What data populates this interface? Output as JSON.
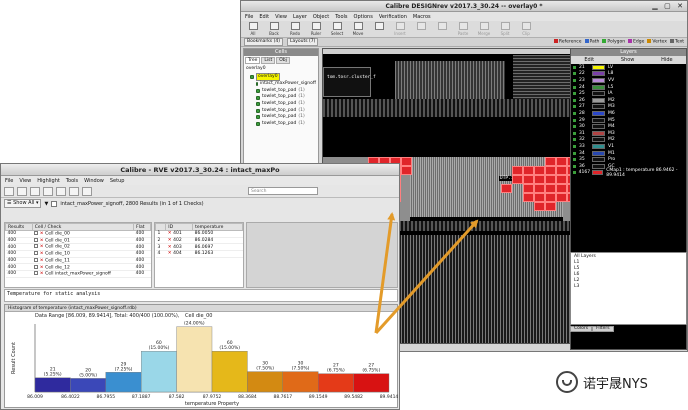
{
  "designrev": {
    "title": "Calibre DESIGNrev v2017.3_30.24  --  overlay0 *",
    "menu": [
      "File",
      "Edit",
      "View",
      "Layer",
      "Object",
      "Tools",
      "Options",
      "Verification",
      "Macros"
    ],
    "toolbar": [
      "All",
      "Back",
      "Redo",
      "Ruler",
      "Select",
      "Move",
      "",
      "Insert",
      "",
      "",
      "Paste",
      "Merge",
      "Split",
      "Clip"
    ],
    "bookmarks": "Bookmarks (4)",
    "layouts": "Layouts (7)",
    "legend": [
      "Reference",
      "Path",
      "Polygon",
      "Edge",
      "Vertex",
      "Text"
    ],
    "legend_colors": [
      "#cc2222",
      "#3366cc",
      "#33aa33",
      "#aa33aa",
      "#cc8800",
      "#666666"
    ],
    "cells": {
      "header": "Cells",
      "tabs": [
        "Tree",
        "List",
        "Obj"
      ],
      "root_label": "overlay0",
      "top": "overlay0",
      "items": [
        {
          "name": "intact_maxPower_signoff",
          "count": ""
        },
        {
          "name": "towlet_top_pad",
          "count": "(1)"
        },
        {
          "name": "towlet_top_pad",
          "count": "(1)"
        },
        {
          "name": "towlet_top_pad",
          "count": "(1)"
        },
        {
          "name": "towlet_top_pad",
          "count": "(1)"
        },
        {
          "name": "towlet_top_pad",
          "count": "(1)"
        },
        {
          "name": "towlet_top_pad",
          "count": "(1)"
        }
      ]
    },
    "canvas": {
      "labels": [
        "tom.tosr.cluster_f",
        "tom.tosr.cluster_f",
        "tom.tosr.cluster_f",
        "tom.tosr.cluster_f",
        "DTP.io"
      ]
    },
    "layers": {
      "header": "Layers",
      "tabs": [
        "Edit",
        "Show",
        "Hide"
      ],
      "rows": [
        {
          "num": "21",
          "name": "LV",
          "color": "#f5f500"
        },
        {
          "num": "22",
          "name": "L8",
          "color": "#7a3fa8"
        },
        {
          "num": "23",
          "name": "VV",
          "color": "#b88ad6"
        },
        {
          "num": "24",
          "name": "L5",
          "color": "#3b8d3b"
        },
        {
          "num": "25",
          "name": "IA",
          "color": "#111111"
        },
        {
          "num": "26",
          "name": "M2",
          "color": "#9b9b9b"
        },
        {
          "num": "27",
          "name": "M3",
          "color": "#111111"
        },
        {
          "num": "28",
          "name": "M6",
          "color": "#2b47c9"
        },
        {
          "num": "29",
          "name": "M5",
          "color": "#111111"
        },
        {
          "num": "30",
          "name": "M4",
          "color": "#111111"
        },
        {
          "num": "31",
          "name": "M3",
          "color": "#b04444"
        },
        {
          "num": "32",
          "name": "M2",
          "color": "#111111"
        },
        {
          "num": "33",
          "name": "V1",
          "color": "#2f8f8f"
        },
        {
          "num": "34",
          "name": "M1",
          "color": "#2848b0"
        },
        {
          "num": "35",
          "name": "Pro",
          "color": "#111111"
        },
        {
          "num": "36",
          "name": "GC",
          "color": "#111111"
        },
        {
          "num": "4167",
          "name": "CMap1 : temperature 86.9462 - 89.9414",
          "color": "#e0252a"
        }
      ],
      "all_layers": [
        "All Layers",
        "L1",
        "L5",
        "L6",
        "L2",
        "L3"
      ],
      "bottom_tabs": [
        "Colors",
        "Filters"
      ]
    }
  },
  "rve": {
    "title": "Calibre - RVE v2017.3_30.24 : intact_maxPo",
    "menu": [
      "File",
      "View",
      "Highlight",
      "Tools",
      "Window",
      "Setup"
    ],
    "search_placeholder": "Search",
    "show_all": "Show All",
    "summary": "intact_maxPower_signoff, 2800 Results (in 1 of 1 Checks)",
    "left_table": {
      "headers": [
        "Results",
        "Cell / Check",
        "Flat"
      ],
      "rows": [
        {
          "results": "400",
          "name": "Cell die_00",
          "flat": "400"
        },
        {
          "results": "400",
          "name": "Cell die_01",
          "flat": "400"
        },
        {
          "results": "400",
          "name": "Cell die_02",
          "flat": "400"
        },
        {
          "results": "400",
          "name": "Cell die_10",
          "flat": "400"
        },
        {
          "results": "400",
          "name": "Cell die_11",
          "flat": "400"
        },
        {
          "results": "400",
          "name": "Cell die_12",
          "flat": "400"
        },
        {
          "results": "400",
          "name": "Cell intact_maxPower_signoff",
          "flat": "400"
        }
      ]
    },
    "right_table": {
      "headers": [
        "",
        "ID",
        "temperature"
      ],
      "rows": [
        {
          "i": "1",
          "id": "401",
          "temp": "86.0050"
        },
        {
          "i": "2",
          "id": "402",
          "temp": "86.0284"
        },
        {
          "i": "3",
          "id": "403",
          "temp": "86.0697"
        },
        {
          "i": "4",
          "id": "404",
          "temp": "86.1263"
        }
      ]
    },
    "description": "Temperature for static analysis",
    "histogram_title": "Histogram of temperature (intact_maxPower_signoff.rdb)",
    "data_range": "Data Range [86.009, 89.9414], Total: 400/400 (100.00%),",
    "data_cell": "Cell die_00"
  },
  "chart_data": {
    "type": "bar",
    "title": "Histogram of temperature (intact_maxPower_signoff.rdb)",
    "xlabel": "temperature Property",
    "ylabel": "Result Count",
    "x_ticks": [
      "86.009",
      "86.4022",
      "86.7955",
      "87.1887",
      "87.582",
      "87.9752",
      "88.3684",
      "88.7617",
      "89.1549",
      "89.5482",
      "89.9414"
    ],
    "values": [
      21,
      20,
      29,
      60,
      96,
      60,
      30,
      30,
      27,
      27
    ],
    "labels": [
      "21 (5.25%)",
      "20 (5.00%)",
      "29 (7.25%)",
      "60 (15.00%)",
      "96 (24.00%)",
      "60 (15.00%)",
      "30 (7.50%)",
      "30 (7.50%)",
      "27 (6.75%)",
      "27 (6.75%)"
    ],
    "colors": [
      "#2f2a9e",
      "#3b48b8",
      "#3a8fd0",
      "#9ad7e8",
      "#f6e3b0",
      "#e5b81a",
      "#d38a12",
      "#e06a18",
      "#e43a18",
      "#d81212"
    ],
    "ylim": [
      0,
      100
    ]
  },
  "watermark": {
    "text": "诺宇晟NYS"
  }
}
